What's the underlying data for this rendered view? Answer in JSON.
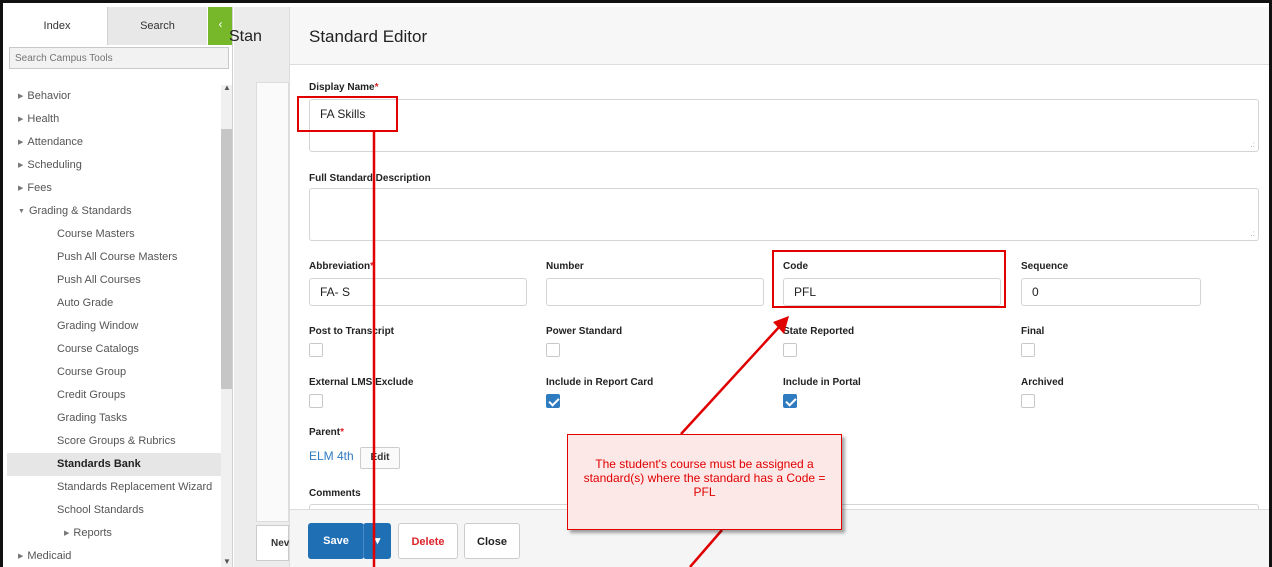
{
  "sidebar": {
    "tabs": {
      "index": "Index",
      "search": "Search"
    },
    "collapse_glyph": "‹",
    "search_placeholder": "Search Campus Tools",
    "items": [
      {
        "label": "Behavior",
        "level": 0,
        "state": "collapsed"
      },
      {
        "label": "Health",
        "level": 0,
        "state": "collapsed"
      },
      {
        "label": "Attendance",
        "level": 0,
        "state": "collapsed"
      },
      {
        "label": "Scheduling",
        "level": 0,
        "state": "collapsed"
      },
      {
        "label": "Fees",
        "level": 0,
        "state": "collapsed"
      },
      {
        "label": "Grading & Standards",
        "level": 0,
        "state": "expanded"
      },
      {
        "label": "Course Masters",
        "level": 1
      },
      {
        "label": "Push All Course Masters",
        "level": 1
      },
      {
        "label": "Push All Courses",
        "level": 1
      },
      {
        "label": "Auto Grade",
        "level": 1
      },
      {
        "label": "Grading Window",
        "level": 1
      },
      {
        "label": "Course Catalogs",
        "level": 1
      },
      {
        "label": "Course Group",
        "level": 1
      },
      {
        "label": "Credit Groups",
        "level": 1
      },
      {
        "label": "Grading Tasks",
        "level": 1
      },
      {
        "label": "Score Groups & Rubrics",
        "level": 1
      },
      {
        "label": "Standards Bank",
        "level": 1,
        "selected": true
      },
      {
        "label": "Standards Replacement Wizard",
        "level": 1
      },
      {
        "label": "School Standards",
        "level": 1
      },
      {
        "label": "Reports",
        "level": 2,
        "state": "collapsed"
      },
      {
        "label": "Medicaid",
        "level": 0,
        "state": "collapsed"
      }
    ]
  },
  "background_page": {
    "title": "Stan",
    "new_button": "Nev"
  },
  "editor": {
    "title": "Standard Editor",
    "display_name": {
      "label": "Display Name",
      "value": "FA Skills"
    },
    "full_description": {
      "label": "Full Standard Description",
      "value": ""
    },
    "abbreviation": {
      "label": "Abbreviation",
      "value": "FA- S"
    },
    "number": {
      "label": "Number",
      "value": ""
    },
    "code": {
      "label": "Code",
      "value": "PFL"
    },
    "sequence": {
      "label": "Sequence",
      "value": "0"
    },
    "checkboxes": {
      "post_to_transcript": {
        "label": "Post to Transcript",
        "checked": false
      },
      "power_standard": {
        "label": "Power Standard",
        "checked": false
      },
      "state_reported": {
        "label": "State Reported",
        "checked": false
      },
      "final": {
        "label": "Final",
        "checked": false
      },
      "external_lms_exclude": {
        "label": "External LMS Exclude",
        "checked": false
      },
      "include_in_report_card": {
        "label": "Include in Report Card",
        "checked": true
      },
      "include_in_portal": {
        "label": "Include in Portal",
        "checked": true
      },
      "archived": {
        "label": "Archived",
        "checked": false
      }
    },
    "parent": {
      "label": "Parent",
      "value": "ELM 4th",
      "edit_label": "Edit"
    },
    "comments": {
      "label": "Comments"
    },
    "required_mark": "*",
    "buttons": {
      "save": "Save",
      "save_dropdown": "▾",
      "delete": "Delete",
      "close": "Close"
    }
  },
  "annotation": {
    "callout_text": "The student's course must be assigned a standard(s) where the standard has a Code = PFL",
    "color": "#e00000"
  },
  "colors": {
    "accent_blue": "#1f6fb5",
    "sidebar_green": "#76b82a",
    "required_red": "#d9242b"
  }
}
